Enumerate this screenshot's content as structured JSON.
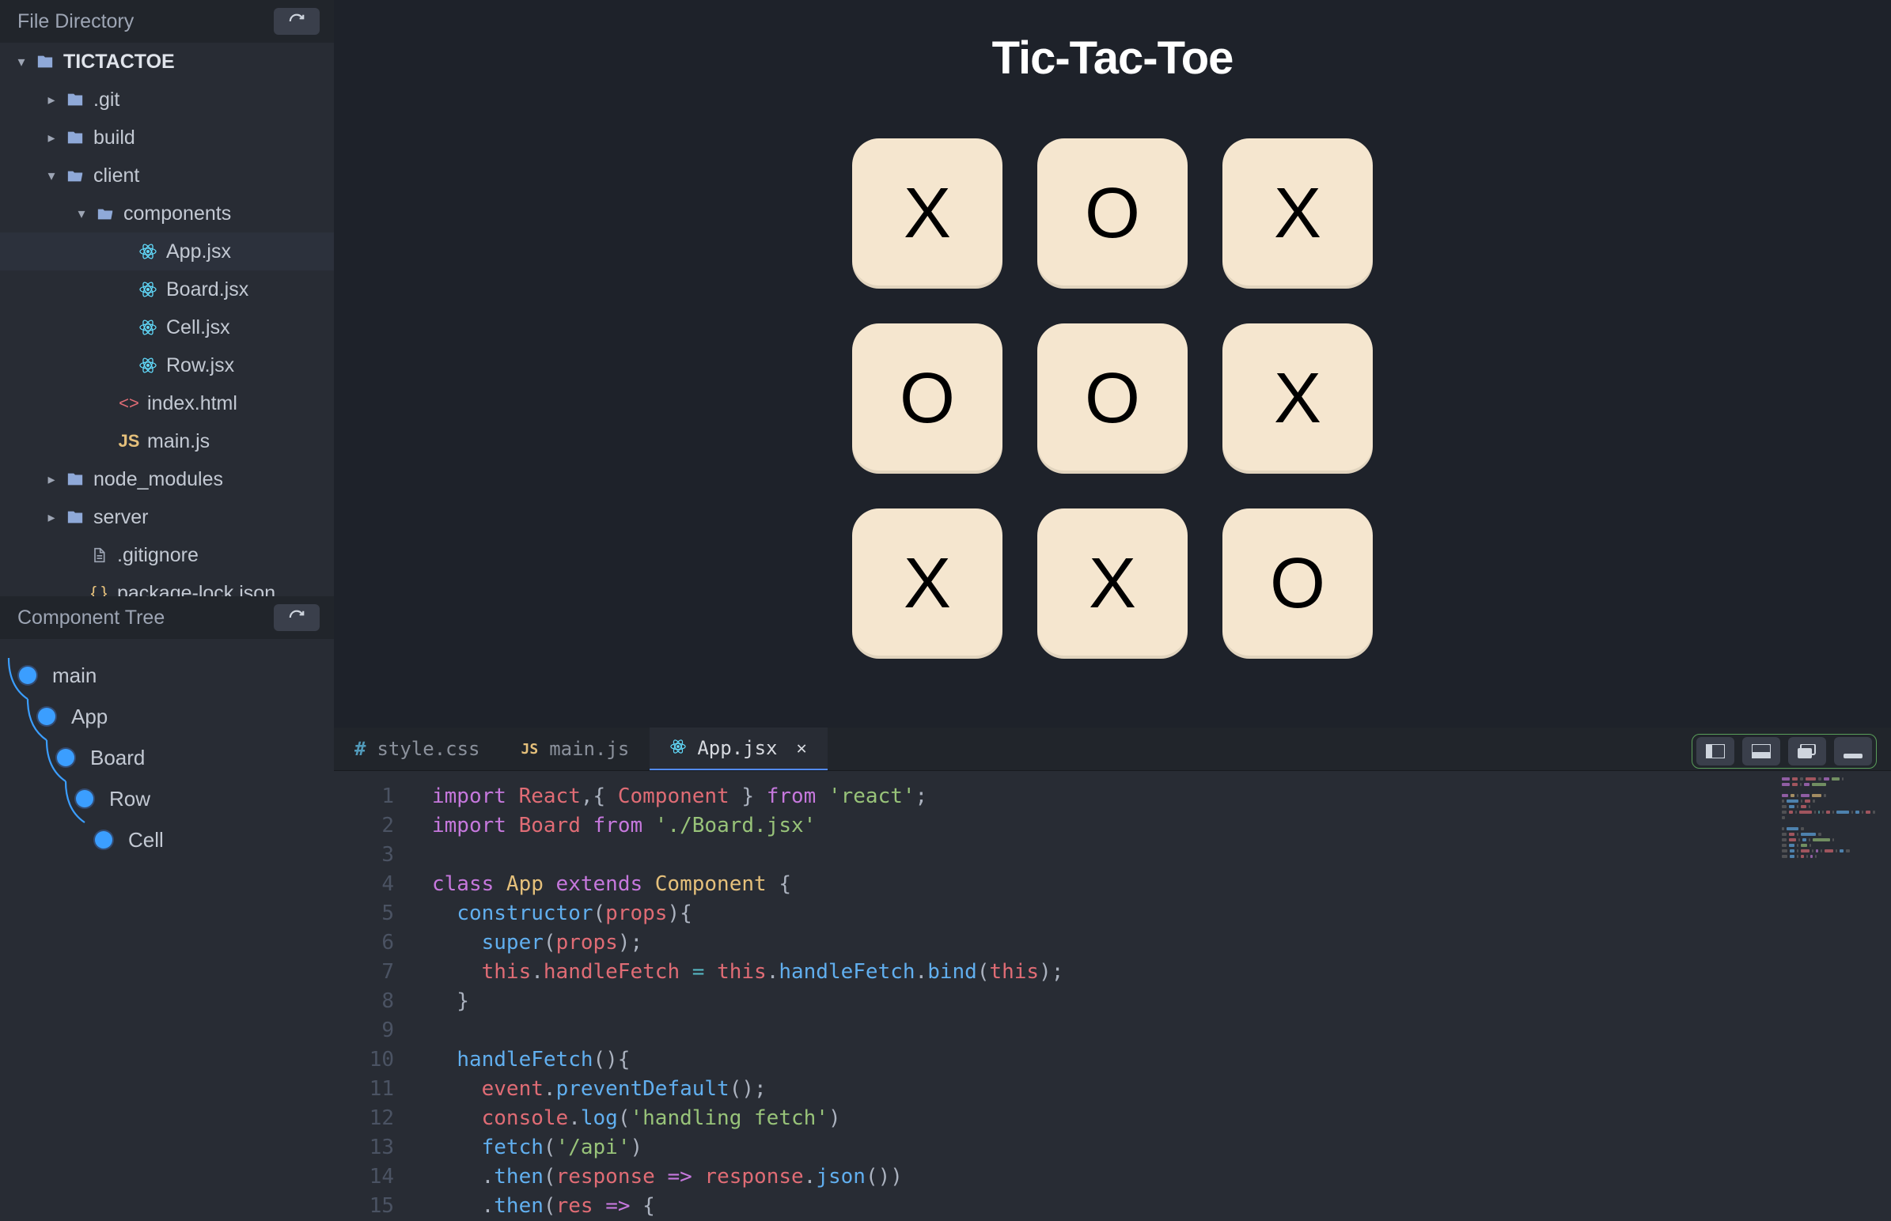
{
  "sidebar": {
    "file_directory_label": "File Directory",
    "component_tree_label": "Component Tree",
    "tree": [
      {
        "name": "TICTACTOE",
        "kind": "root-folder",
        "indent": 20,
        "chevron": "down"
      },
      {
        "name": ".git",
        "kind": "folder",
        "indent": 58,
        "chevron": "right"
      },
      {
        "name": "build",
        "kind": "folder",
        "indent": 58,
        "chevron": "right"
      },
      {
        "name": "client",
        "kind": "folder-open",
        "indent": 58,
        "chevron": "down"
      },
      {
        "name": "components",
        "kind": "folder-open",
        "indent": 96,
        "chevron": "down"
      },
      {
        "name": "App.jsx",
        "kind": "react",
        "indent": 150,
        "chevron": "",
        "selected": true
      },
      {
        "name": "Board.jsx",
        "kind": "react",
        "indent": 150,
        "chevron": ""
      },
      {
        "name": "Cell.jsx",
        "kind": "react",
        "indent": 150,
        "chevron": ""
      },
      {
        "name": "Row.jsx",
        "kind": "react",
        "indent": 150,
        "chevron": ""
      },
      {
        "name": "index.html",
        "kind": "html",
        "indent": 126,
        "chevron": ""
      },
      {
        "name": "main.js",
        "kind": "js",
        "indent": 126,
        "chevron": ""
      },
      {
        "name": "node_modules",
        "kind": "folder",
        "indent": 58,
        "chevron": "right"
      },
      {
        "name": "server",
        "kind": "folder",
        "indent": 58,
        "chevron": "right"
      },
      {
        "name": ".gitignore",
        "kind": "file",
        "indent": 88,
        "chevron": ""
      },
      {
        "name": "package-lock.json",
        "kind": "json",
        "indent": 88,
        "chevron": ""
      }
    ],
    "component_tree": [
      {
        "name": "main",
        "indent": 0
      },
      {
        "name": "App",
        "indent": 24
      },
      {
        "name": "Board",
        "indent": 48
      },
      {
        "name": "Row",
        "indent": 72
      },
      {
        "name": "Cell",
        "indent": 96
      }
    ]
  },
  "preview": {
    "title": "Tic-Tac-Toe",
    "cells": [
      "X",
      "O",
      "X",
      "O",
      "O",
      "X",
      "X",
      "X",
      "O"
    ]
  },
  "editor": {
    "tabs": [
      {
        "icon": "css",
        "icon_label": "#",
        "label": "style.css"
      },
      {
        "icon": "js",
        "icon_label": "JS",
        "label": "main.js"
      },
      {
        "icon": "react",
        "icon_label": "⚛",
        "label": "App.jsx",
        "active": true,
        "closable": true
      }
    ],
    "lines": [
      {
        "n": 1,
        "tokens": [
          [
            "c-key",
            "import "
          ],
          [
            "c-def",
            "React"
          ],
          [
            "c-pun",
            ",{ "
          ],
          [
            "c-def",
            "Component"
          ],
          [
            "c-pun",
            " } "
          ],
          [
            "c-key",
            "from "
          ],
          [
            "c-str",
            "'react'"
          ],
          [
            "c-pun",
            ";"
          ]
        ]
      },
      {
        "n": 2,
        "tokens": [
          [
            "c-key",
            "import "
          ],
          [
            "c-def",
            "Board"
          ],
          [
            "c-pun",
            " "
          ],
          [
            "c-key",
            "from "
          ],
          [
            "c-str",
            "'./Board.jsx'"
          ]
        ]
      },
      {
        "n": 3,
        "tokens": []
      },
      {
        "n": 4,
        "tokens": [
          [
            "c-key",
            "class "
          ],
          [
            "c-type",
            "App"
          ],
          [
            "c-pun",
            " "
          ],
          [
            "c-key",
            "extends "
          ],
          [
            "c-type",
            "Component"
          ],
          [
            "c-pun",
            " {"
          ]
        ]
      },
      {
        "n": 5,
        "tokens": [
          [
            "c-pun",
            "  "
          ],
          [
            "c-var",
            "constructor"
          ],
          [
            "c-pun",
            "("
          ],
          [
            "c-def",
            "props"
          ],
          [
            "c-pun",
            "){"
          ]
        ]
      },
      {
        "n": 6,
        "tokens": [
          [
            "c-pun",
            "    "
          ],
          [
            "c-var",
            "super"
          ],
          [
            "c-pun",
            "("
          ],
          [
            "c-def",
            "props"
          ],
          [
            "c-pun",
            ");"
          ]
        ]
      },
      {
        "n": 7,
        "tokens": [
          [
            "c-pun",
            "    "
          ],
          [
            "c-this",
            "this"
          ],
          [
            "c-pun",
            "."
          ],
          [
            "c-prop",
            "handleFetch"
          ],
          [
            "c-pun",
            " "
          ],
          [
            "c-op",
            "="
          ],
          [
            "c-pun",
            " "
          ],
          [
            "c-this",
            "this"
          ],
          [
            "c-pun",
            "."
          ],
          [
            "c-var",
            "handleFetch"
          ],
          [
            "c-pun",
            "."
          ],
          [
            "c-var",
            "bind"
          ],
          [
            "c-pun",
            "("
          ],
          [
            "c-this",
            "this"
          ],
          [
            "c-pun",
            ");"
          ]
        ]
      },
      {
        "n": 8,
        "tokens": [
          [
            "c-pun",
            "  }"
          ]
        ]
      },
      {
        "n": 9,
        "tokens": []
      },
      {
        "n": 10,
        "tokens": [
          [
            "c-pun",
            "  "
          ],
          [
            "c-var",
            "handleFetch"
          ],
          [
            "c-pun",
            "(){"
          ]
        ]
      },
      {
        "n": 11,
        "tokens": [
          [
            "c-pun",
            "    "
          ],
          [
            "c-def",
            "event"
          ],
          [
            "c-pun",
            "."
          ],
          [
            "c-var",
            "preventDefault"
          ],
          [
            "c-pun",
            "();"
          ]
        ]
      },
      {
        "n": 12,
        "tokens": [
          [
            "c-pun",
            "    "
          ],
          [
            "c-def",
            "console"
          ],
          [
            "c-pun",
            "."
          ],
          [
            "c-var",
            "log"
          ],
          [
            "c-pun",
            "("
          ],
          [
            "c-str",
            "'handling fetch'"
          ],
          [
            "c-pun",
            ")"
          ]
        ]
      },
      {
        "n": 13,
        "tokens": [
          [
            "c-pun",
            "    "
          ],
          [
            "c-var",
            "fetch"
          ],
          [
            "c-pun",
            "("
          ],
          [
            "c-str",
            "'/api'"
          ],
          [
            "c-pun",
            ")"
          ]
        ]
      },
      {
        "n": 14,
        "tokens": [
          [
            "c-pun",
            "    ."
          ],
          [
            "c-var",
            "then"
          ],
          [
            "c-pun",
            "("
          ],
          [
            "c-def",
            "response"
          ],
          [
            "c-pun",
            " "
          ],
          [
            "c-key",
            "=>"
          ],
          [
            "c-pun",
            " "
          ],
          [
            "c-def",
            "response"
          ],
          [
            "c-pun",
            "."
          ],
          [
            "c-var",
            "json"
          ],
          [
            "c-pun",
            "())"
          ]
        ]
      },
      {
        "n": 15,
        "tokens": [
          [
            "c-pun",
            "    ."
          ],
          [
            "c-var",
            "then"
          ],
          [
            "c-pun",
            "("
          ],
          [
            "c-def",
            "res"
          ],
          [
            "c-pun",
            " "
          ],
          [
            "c-key",
            "=>"
          ],
          [
            "c-pun",
            " {"
          ]
        ]
      }
    ]
  }
}
